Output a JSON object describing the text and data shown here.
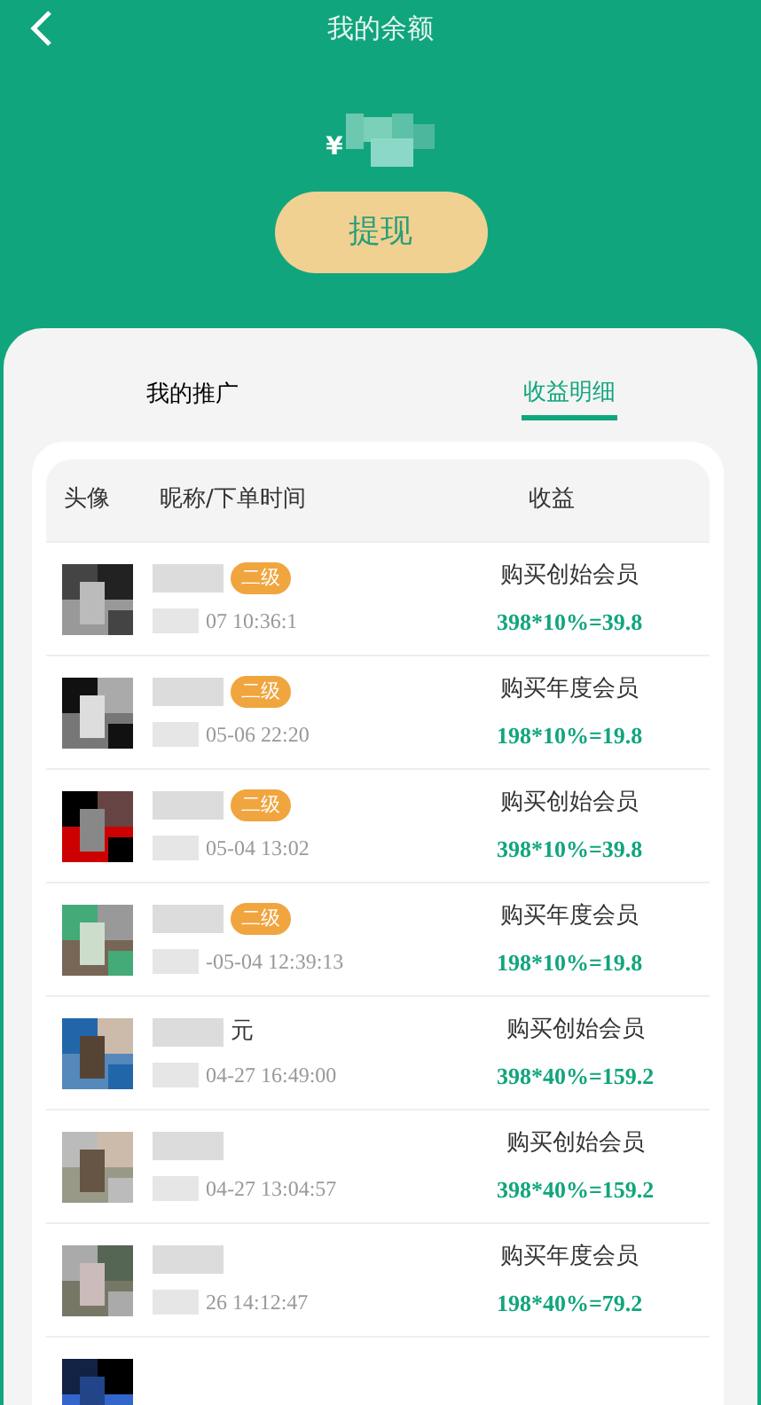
{
  "header": {
    "title": "我的余额",
    "currency": "¥"
  },
  "withdraw_button": "提现",
  "tabs": [
    {
      "label": "我的推广",
      "selected": false
    },
    {
      "label": "收益明细",
      "selected": true
    }
  ],
  "table": {
    "columns": [
      "头像",
      "昵称/下单时间",
      "收益"
    ],
    "rows": [
      {
        "level_badge": "二级",
        "time": "07 10:36:1",
        "income_title": "购买创始会员",
        "income_formula": "398*10%=39.8"
      },
      {
        "level_badge": "二级",
        "time": "05-06 22:20",
        "income_title": "购买年度会员",
        "income_formula": "198*10%=19.8"
      },
      {
        "level_badge": "二级",
        "time": "05-04 13:02",
        "income_title": "购买创始会员",
        "income_formula": "398*10%=39.8"
      },
      {
        "level_badge": "二级",
        "time": "-05-04 12:39:13",
        "income_title": "购买年度会员",
        "income_formula": "198*10%=19.8"
      },
      {
        "name": "元",
        "time": "04-27 16:49:00",
        "income_title": "购买创始会员",
        "income_formula": "398*40%=159.2"
      },
      {
        "time": "04-27 13:04:57",
        "income_title": "购买创始会员",
        "income_formula": "398*40%=159.2"
      },
      {
        "time": "26 14:12:47",
        "income_title": "购买年度会员",
        "income_formula": "198*40%=79.2"
      }
    ]
  }
}
